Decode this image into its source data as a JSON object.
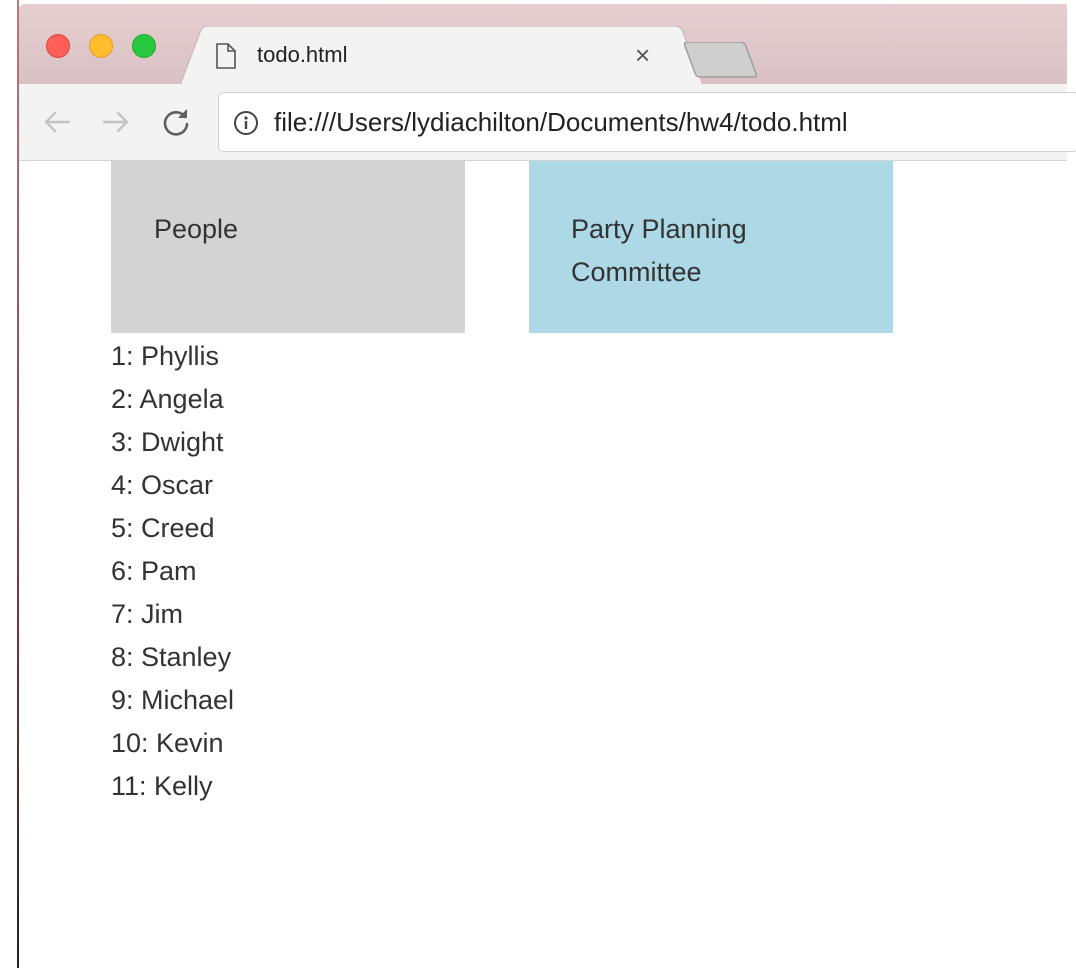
{
  "browser": {
    "tab": {
      "title": "todo.html",
      "close_glyph": "×"
    },
    "address_bar": {
      "url": "file:///Users/lydiachilton/Documents/hw4/todo.html"
    },
    "icons": {
      "back": "arrow-left-icon",
      "forward": "arrow-right-icon",
      "reload": "reload-icon",
      "info": "info-icon",
      "document": "document-icon"
    }
  },
  "page": {
    "tiles": {
      "people": {
        "label": "People",
        "color": "#d3d3d3"
      },
      "party_planning": {
        "label": "Party Planning Committee",
        "color": "#add8e6"
      }
    },
    "people": [
      "1: Phyllis",
      "2: Angela",
      "3: Dwight",
      "4: Oscar",
      "5: Creed",
      "6: Pam",
      "7: Jim",
      "8: Stanley",
      "9: Michael",
      "10: Kevin",
      "11: Kelly"
    ]
  }
}
